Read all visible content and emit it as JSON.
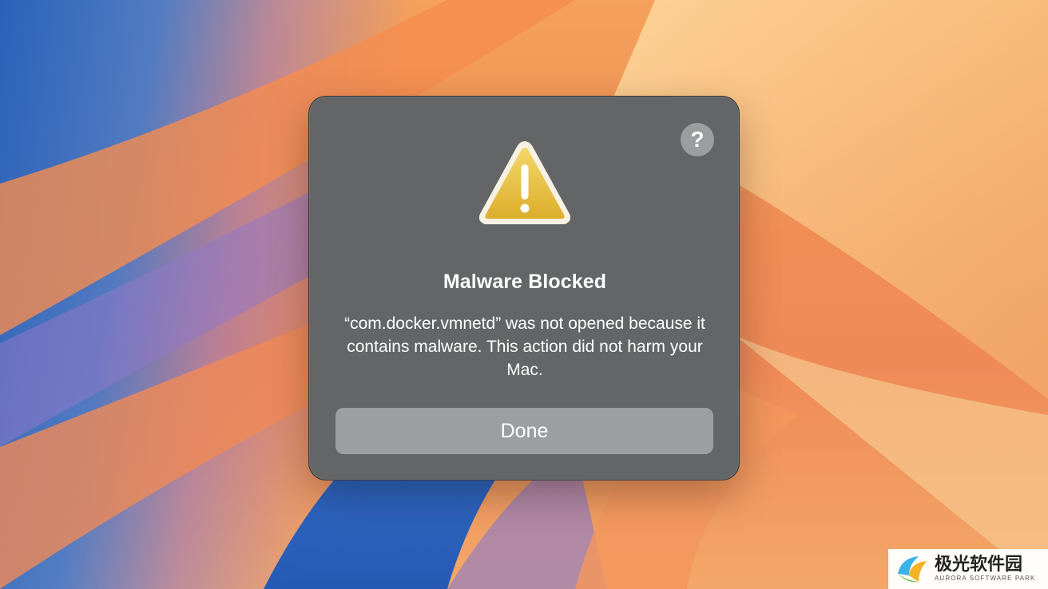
{
  "dialog": {
    "help_label": "?",
    "title": "Malware Blocked",
    "message": "“com.docker.vmnetd” was not opened because it contains malware. This action did not harm your Mac.",
    "done_label": "Done"
  },
  "icons": {
    "help": "question-mark-icon",
    "warning": "warning-triangle-icon"
  },
  "watermark": {
    "main_text": "极光软件园",
    "sub_text": "AURORA SOFTWARE PARK"
  },
  "colors": {
    "dialog_background": "#636567",
    "button_background": "#9c9fa1",
    "warning_fill": "#e8c13e"
  }
}
